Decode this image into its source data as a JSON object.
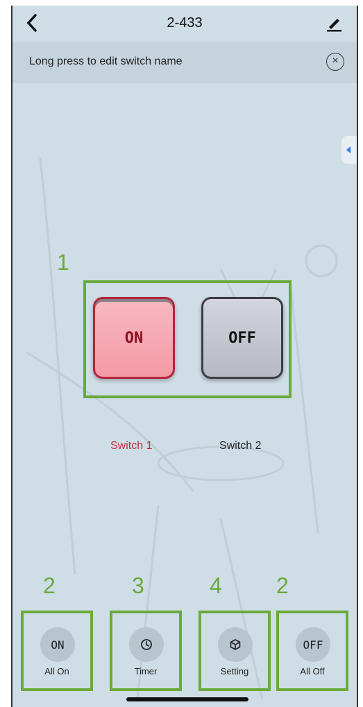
{
  "header": {
    "title": "2-433",
    "back_icon": "chevron-left-icon",
    "edit_icon": "pencil-icon"
  },
  "tip": {
    "text": "Long press to edit switch name",
    "close_icon": "close-circle-icon"
  },
  "annotations": {
    "a1": "1",
    "a2_left": "2",
    "a3": "3",
    "a4": "4",
    "a2_right": "2"
  },
  "switches": [
    {
      "label": "Switch 1",
      "state": "ON",
      "label_color": "#c0303f"
    },
    {
      "label": "Switch 2",
      "state": "OFF",
      "label_color": "#222222"
    }
  ],
  "bottom": [
    {
      "icon_text": "ON",
      "label": "All On"
    },
    {
      "icon": "clock-icon",
      "label": "Timer"
    },
    {
      "icon": "cube-icon",
      "label": "Setting"
    },
    {
      "icon_text": "OFF",
      "label": "All Off"
    }
  ],
  "colors": {
    "annotation_green": "#6aaa3a",
    "background": "#cfdde6",
    "accent_blue": "#2d7be5"
  }
}
